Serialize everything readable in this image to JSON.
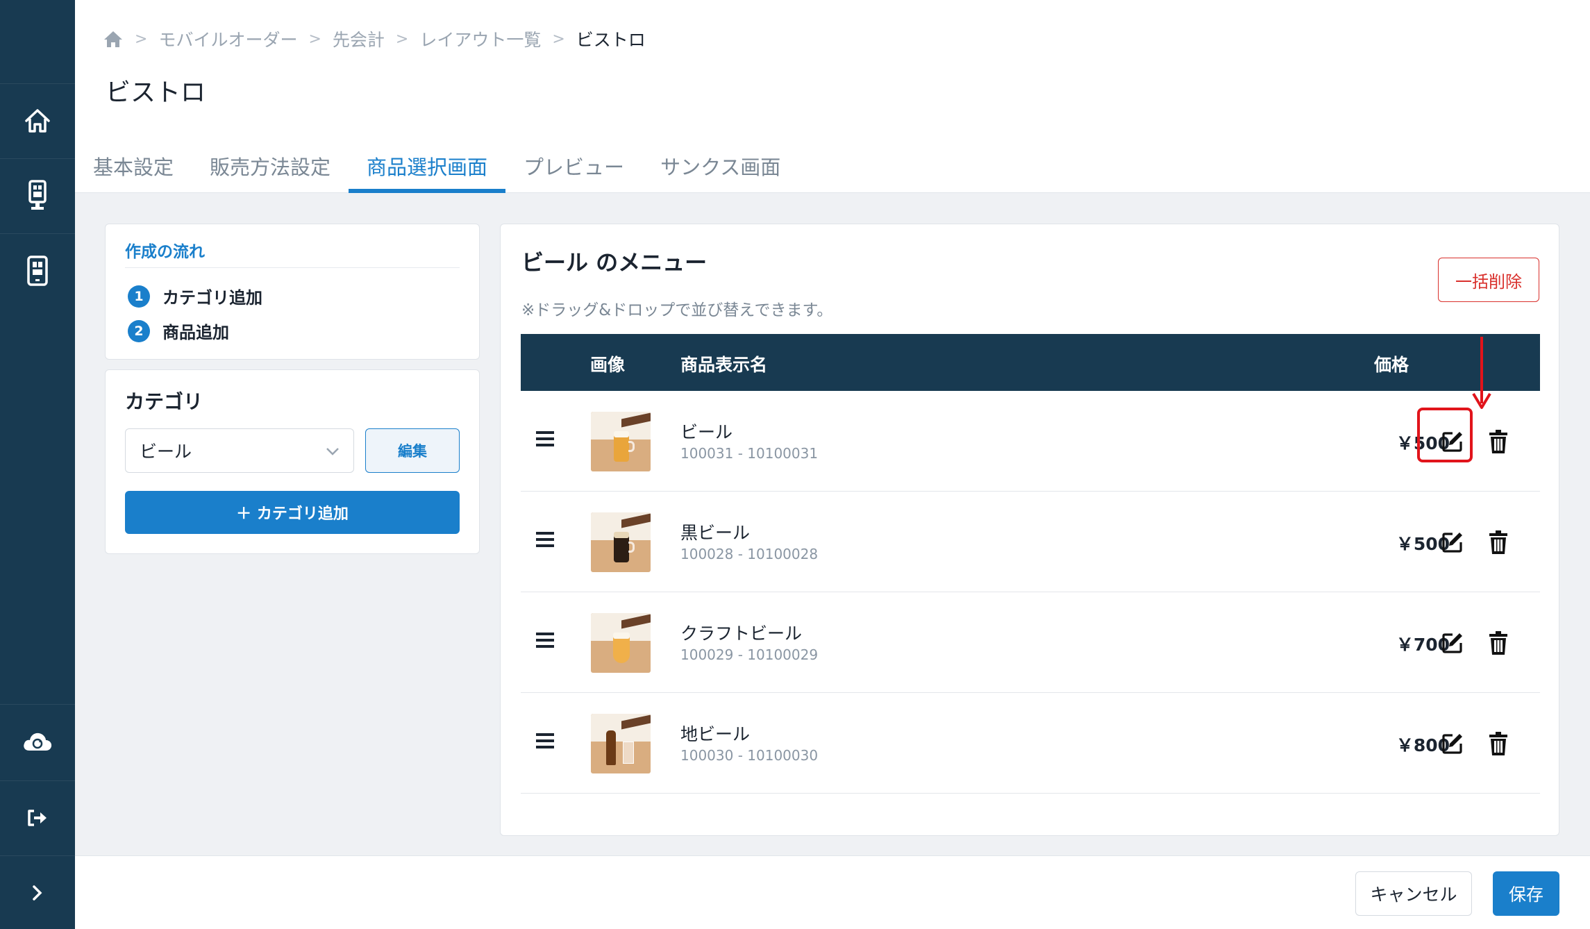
{
  "sidebar": {
    "items": [
      {
        "icon": "home-icon"
      },
      {
        "icon": "kiosk-icon"
      },
      {
        "icon": "tablet-icon"
      },
      {
        "icon": "cloud-sync-icon"
      },
      {
        "icon": "logout-icon"
      },
      {
        "icon": "chevron-right-icon"
      }
    ]
  },
  "breadcrumb": {
    "home_icon": "home-icon",
    "items": [
      "モバイルオーダー",
      "先会計",
      "レイアウト一覧"
    ],
    "current": "ビストロ",
    "separator": ">"
  },
  "page": {
    "title": "ビストロ"
  },
  "tabs": [
    {
      "label": "基本設定",
      "active": false
    },
    {
      "label": "販売方法設定",
      "active": false
    },
    {
      "label": "商品選択画面",
      "active": true
    },
    {
      "label": "プレビュー",
      "active": false
    },
    {
      "label": "サンクス画面",
      "active": false
    }
  ],
  "flow": {
    "title": "作成の流れ",
    "steps": [
      {
        "num": "1",
        "label": "カテゴリ追加"
      },
      {
        "num": "2",
        "label": "商品追加"
      }
    ]
  },
  "category": {
    "title": "カテゴリ",
    "selected": "ビール",
    "edit_label": "編集",
    "add_label": "＋ カテゴリ追加"
  },
  "menu": {
    "title": "ビール のメニュー",
    "note": "※ドラッグ&ドロップで並び替えできます。",
    "bulk_delete_label": "一括削除",
    "columns": {
      "image": "画像",
      "name": "商品表示名",
      "price": "価格"
    },
    "items": [
      {
        "name": "ビール",
        "code": "100031 - 10100031",
        "price": "￥500",
        "image": "beer-mug"
      },
      {
        "name": "黒ビール",
        "code": "100028 - 10100028",
        "price": "￥500",
        "image": "dark-beer-mug"
      },
      {
        "name": "クラフトビール",
        "code": "100029 - 10100029",
        "price": "￥700",
        "image": "craft-beer-glass"
      },
      {
        "name": "地ビール",
        "code": "100030 - 10100030",
        "price": "￥800",
        "image": "beer-bottle"
      }
    ]
  },
  "footer": {
    "cancel_label": "キャンセル",
    "save_label": "保存"
  },
  "colors": {
    "sidebar": "#183a51",
    "accent": "#1a7fcb",
    "danger": "#d9302c",
    "highlight": "#e1141b"
  }
}
